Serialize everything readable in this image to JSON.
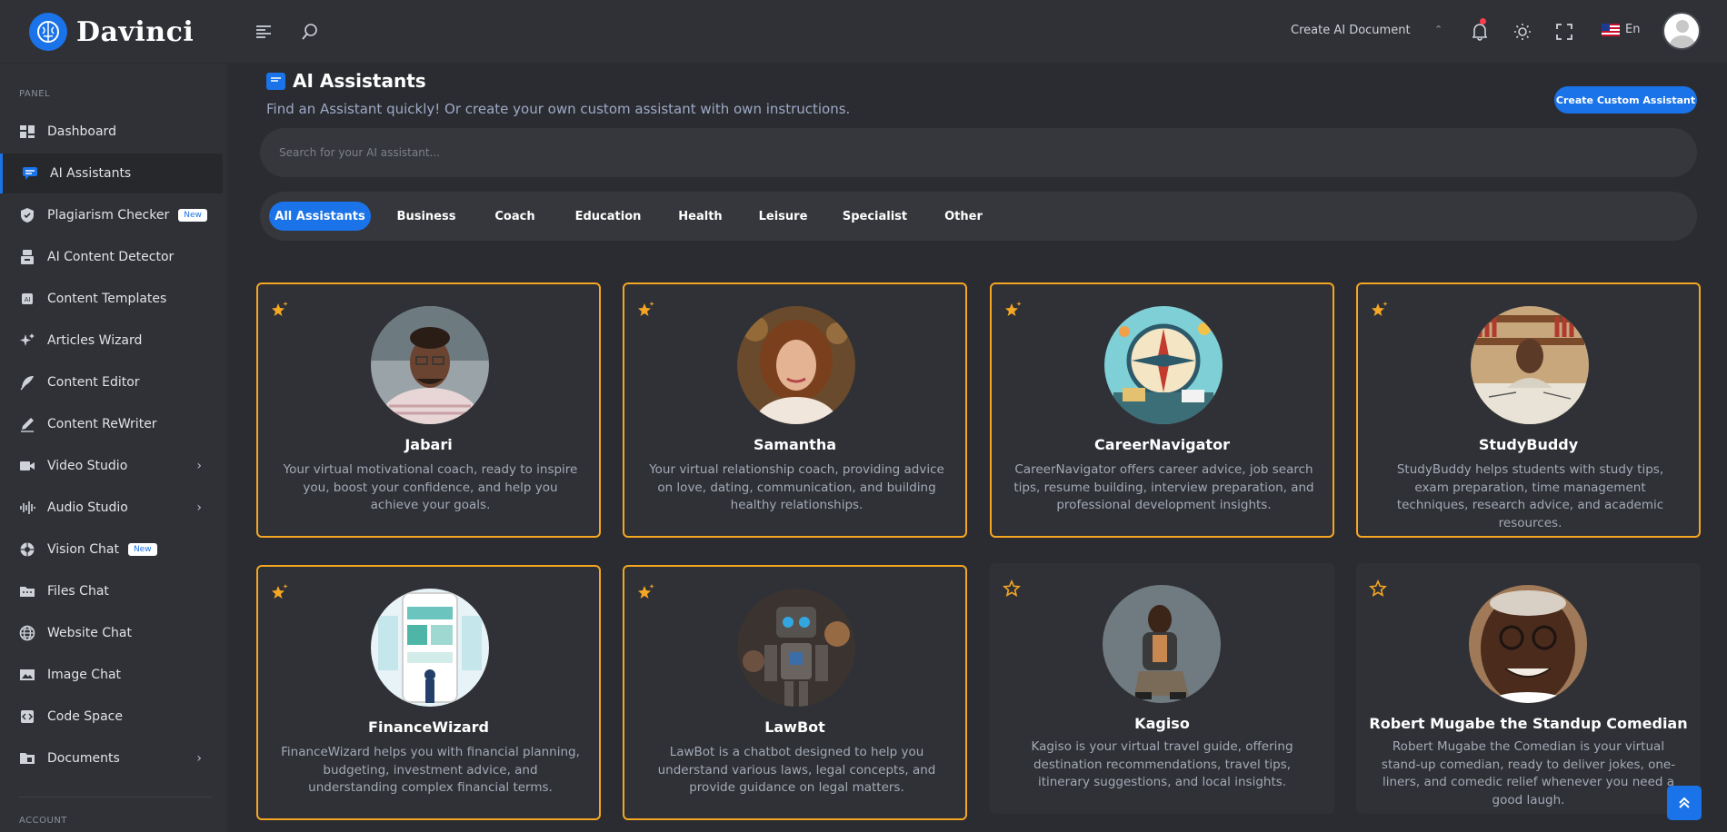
{
  "brand": {
    "name": "Davinci"
  },
  "header": {
    "create_doc_label": "Create AI Document",
    "language": "En"
  },
  "sidebar": {
    "panel_label": "PANEL",
    "account_label": "ACCOUNT",
    "items": [
      {
        "label": "Dashboard",
        "icon": "dashboard-icon"
      },
      {
        "label": "AI Assistants",
        "icon": "chat-icon",
        "active": true
      },
      {
        "label": "Plagiarism Checker",
        "icon": "shield-icon",
        "badge": "New"
      },
      {
        "label": "AI Content Detector",
        "icon": "detector-icon"
      },
      {
        "label": "Content Templates",
        "icon": "ai-chip-icon"
      },
      {
        "label": "Articles Wizard",
        "icon": "sparkle-icon"
      },
      {
        "label": "Content Editor",
        "icon": "feather-icon"
      },
      {
        "label": "Content ReWriter",
        "icon": "pen-icon"
      },
      {
        "label": "Video Studio",
        "icon": "video-icon",
        "expandable": true
      },
      {
        "label": "Audio Studio",
        "icon": "waveform-icon",
        "expandable": true
      },
      {
        "label": "Vision Chat",
        "icon": "vision-icon",
        "badge": "New"
      },
      {
        "label": "Files Chat",
        "icon": "folder-icon"
      },
      {
        "label": "Website Chat",
        "icon": "globe-icon"
      },
      {
        "label": "Image Chat",
        "icon": "image-icon"
      },
      {
        "label": "Code Space",
        "icon": "code-icon"
      },
      {
        "label": "Documents",
        "icon": "documents-icon",
        "expandable": true
      }
    ]
  },
  "page": {
    "title": "AI Assistants",
    "subtitle": "Find an Assistant quickly! Or create your own custom assistant with own instructions.",
    "create_button": "Create Custom Assistant",
    "search_placeholder": "Search for your AI assistant..."
  },
  "tabs": [
    {
      "label": "All Assistants",
      "active": true
    },
    {
      "label": "Business"
    },
    {
      "label": "Coach"
    },
    {
      "label": "Education"
    },
    {
      "label": "Health"
    },
    {
      "label": "Leisure"
    },
    {
      "label": "Specialist"
    },
    {
      "label": "Other"
    }
  ],
  "assistants": [
    {
      "name": "Jabari",
      "description": "Your virtual motivational coach, ready to inspire you, boost your confidence, and help you achieve your goals.",
      "featured": true
    },
    {
      "name": "Samantha",
      "description": "Your virtual relationship coach, providing advice on love, dating, communication, and building healthy relationships.",
      "featured": true
    },
    {
      "name": "CareerNavigator",
      "description": "CareerNavigator offers career advice, job search tips, resume building, interview preparation, and professional development insights.",
      "featured": true
    },
    {
      "name": "StudyBuddy",
      "description": "StudyBuddy helps students with study tips, exam preparation, time management techniques, research advice, and academic resources.",
      "featured": true
    },
    {
      "name": "FinanceWizard",
      "description": "FinanceWizard helps you with financial planning, budgeting, investment advice, and understanding complex financial terms.",
      "featured": true
    },
    {
      "name": "LawBot",
      "description": "LawBot is a chatbot designed to help you understand various laws, legal concepts, and provide guidance on legal matters.",
      "featured": true
    },
    {
      "name": "Kagiso",
      "description": "Kagiso is your virtual travel guide, offering destination recommendations, travel tips, itinerary suggestions, and local insights.",
      "featured": false
    },
    {
      "name": "Robert Mugabe the Standup Comedian",
      "description": "Robert Mugabe the Comedian is your virtual stand-up comedian, ready to deliver jokes, one-liners, and comedic relief whenever you need a good laugh.",
      "featured": false
    }
  ],
  "colors": {
    "accent": "#1a73e8",
    "featured_border": "#f5a623",
    "background": "#2a2c31",
    "panel": "#2f3136"
  }
}
